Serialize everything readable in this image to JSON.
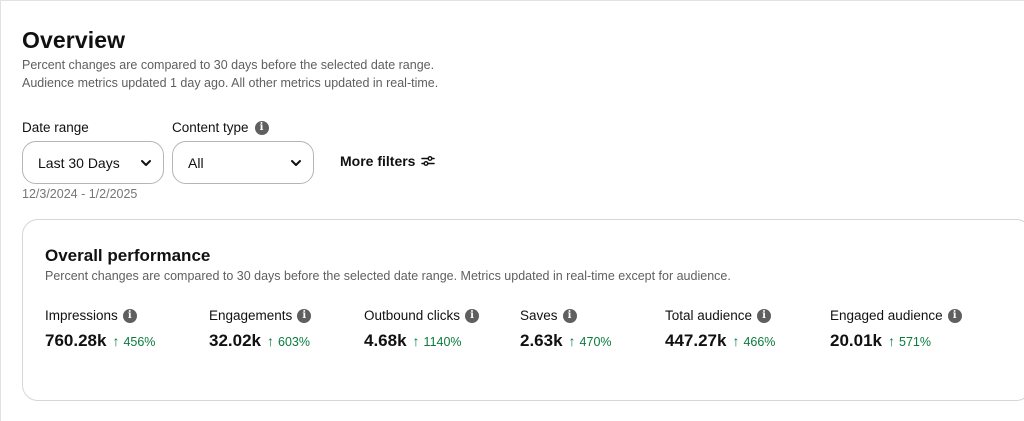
{
  "header": {
    "title": "Overview",
    "subtitle_line1": "Percent changes are compared to 30 days before the selected date range.",
    "subtitle_line2": "Audience metrics updated 1 day ago. All other metrics updated in real-time."
  },
  "filters": {
    "date_range_label": "Date range",
    "date_range_value": "Last 30 Days",
    "date_range_dates": "12/3/2024 - 1/2/2025",
    "content_type_label": "Content type",
    "content_type_value": "All",
    "more_filters_label": "More filters",
    "icons": {
      "info": "info-icon",
      "chevron": "chevron-down-icon",
      "filters": "filter-sliders-icon"
    }
  },
  "performance": {
    "title": "Overall performance",
    "subtitle": "Percent changes are compared to 30 days before the selected date range. Metrics updated in real-time except for audience.",
    "metrics": [
      {
        "label": "Impressions",
        "value": "760.28k",
        "change": "456%"
      },
      {
        "label": "Engagements",
        "value": "32.02k",
        "change": "603%"
      },
      {
        "label": "Outbound clicks",
        "value": "4.68k",
        "change": "1140%"
      },
      {
        "label": "Saves",
        "value": "2.63k",
        "change": "470%"
      },
      {
        "label": "Total audience",
        "value": "447.27k",
        "change": "466%"
      },
      {
        "label": "Engaged audience",
        "value": "20.01k",
        "change": "571%"
      }
    ]
  },
  "colors": {
    "positive_change": "#0a7a3d",
    "muted_text": "#5f5f5f",
    "border": "#b5b5b5"
  }
}
